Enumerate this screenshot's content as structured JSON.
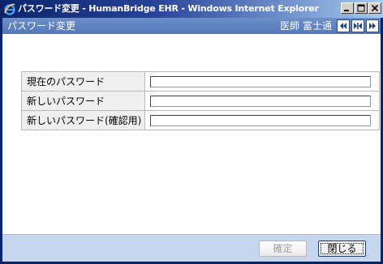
{
  "window": {
    "title": "パスワード変更 - HumanBridge EHR - Windows Internet Explorer"
  },
  "header": {
    "title": "パスワード変更",
    "user": "医師 富士通"
  },
  "form": {
    "rows": [
      {
        "label": "現在のパスワード",
        "value": ""
      },
      {
        "label": "新しいパスワード",
        "value": ""
      },
      {
        "label": "新しいパスワード(確認用)",
        "value": ""
      }
    ]
  },
  "footer": {
    "confirm_label": "確定",
    "close_label": "閉じる"
  },
  "colors": {
    "titlebar": "#0a246a",
    "appbar": "#5478b9",
    "footer": "#c6d6ee"
  }
}
